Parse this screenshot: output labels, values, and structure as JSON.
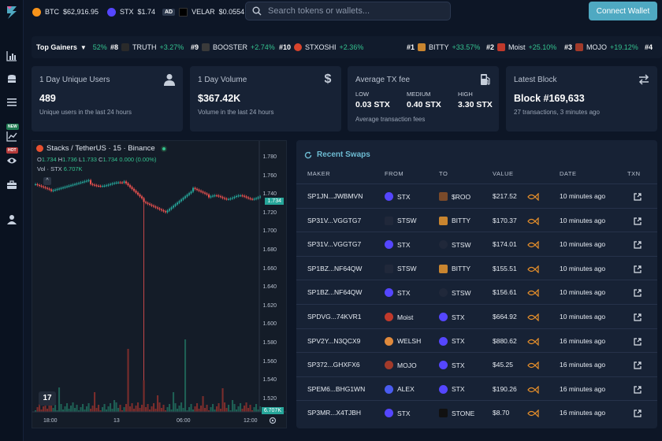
{
  "top_bar": {
    "tickers": [
      {
        "symbol": "BTC",
        "price": "$62,916.95",
        "color": "#f7931a"
      },
      {
        "symbol": "STX",
        "price": "$1.74",
        "color": "#5546ff"
      },
      {
        "ad": "AD",
        "symbol": "VELAR",
        "price": "$0.0554",
        "color": "#000000"
      }
    ],
    "search_placeholder": "Search tokens or wallets...",
    "connect_label": "Connect Wallet"
  },
  "sidebar": {
    "items": [
      {
        "icon": "bar-chart-icon"
      },
      {
        "icon": "coins-icon"
      },
      {
        "icon": "list-icon"
      },
      {
        "badge": "NEW",
        "icon": "trending-chart-icon",
        "badge_color": "#1f7a52"
      },
      {
        "badge": "HOT",
        "icon": "eye-icon",
        "badge_color": "#b43a3a"
      },
      {
        "icon": "briefcase-icon"
      },
      {
        "icon": "user-icon"
      }
    ]
  },
  "gainers": {
    "label": "Top Gainers",
    "pct": "52%",
    "items": [
      {
        "rank": "#8",
        "name": "TRUTH",
        "pct": "+3.27%"
      },
      {
        "rank": "#9",
        "name": "BOOSTER",
        "pct": "+2.74%"
      },
      {
        "rank": "#10",
        "name": "STXOSHI",
        "pct": "+2.36%"
      },
      {
        "rank": "#1",
        "name": "BITTY",
        "pct": "+33.57%"
      },
      {
        "rank": "#2",
        "name": "Moist",
        "pct": "+25.10%"
      },
      {
        "rank": "#3",
        "name": "MOJO",
        "pct": "+19.12%"
      },
      {
        "rank": "#4",
        "name": "",
        "pct": ""
      }
    ]
  },
  "stats": {
    "users": {
      "label": "1 Day Unique Users",
      "value": "489",
      "sub": "Unique users in the last 24 hours"
    },
    "volume": {
      "label": "1 Day Volume",
      "value": "$367.42K",
      "sub": "Volume in the last 24 hours"
    },
    "txfee": {
      "label": "Average TX fee",
      "low_label": "LOW",
      "low": "0.03 STX",
      "medium_label": "MEDIUM",
      "medium": "0.40 STX",
      "high_label": "HIGH",
      "high": "3.30 STX",
      "sub": "Average transaction fees"
    },
    "block": {
      "label": "Latest Block",
      "value": "Block #169,633",
      "sub": "27 transactions, 3 minutes ago"
    }
  },
  "chart": {
    "title": "Stacks / TetherUS · 15 · Binance",
    "ohlc": {
      "o": "1.734",
      "h": "1.736",
      "l": "1.733",
      "c": "1.734",
      "change": "0.000 (0.00%)"
    },
    "vol_label": "Vol · STX",
    "vol_value": "6.707K",
    "price_tag": "1.734",
    "vol_tag": "6.707K",
    "y_ticks": [
      "1.780",
      "1.760",
      "1.740",
      "1.720",
      "1.700",
      "1.680",
      "1.660",
      "1.640",
      "1.620",
      "1.600",
      "1.580",
      "1.560",
      "1.540",
      "1.520"
    ],
    "x_ticks": [
      "18:00",
      "13",
      "06:00",
      "12:00"
    ],
    "up_color": "#26a69a",
    "down_color": "#ef5350"
  },
  "swaps": {
    "title": "Recent Swaps",
    "headers": {
      "maker": "MAKER",
      "from": "FROM",
      "to": "TO",
      "value": "VALUE",
      "date": "DATE",
      "txn": "TXN"
    },
    "rows": [
      {
        "maker": "SP1JN...JWBMVN",
        "from": "STX",
        "to": "$ROO",
        "value": "$217.52",
        "date": "10 minutes ago",
        "fish": true
      },
      {
        "maker": "SP31V...VGGTG7",
        "from": "STSW",
        "to": "BITTY",
        "value": "$170.37",
        "date": "10 minutes ago",
        "fish": true
      },
      {
        "maker": "SP31V...VGGTG7",
        "from": "STX",
        "to": "STSW",
        "value": "$174.01",
        "date": "10 minutes ago",
        "fish": true
      },
      {
        "maker": "SP1BZ...NF64QW",
        "from": "STSW",
        "to": "BITTY",
        "value": "$155.51",
        "date": "10 minutes ago",
        "fish": true
      },
      {
        "maker": "SP1BZ...NF64QW",
        "from": "STX",
        "to": "STSW",
        "value": "$156.61",
        "date": "10 minutes ago",
        "fish": true
      },
      {
        "maker": "SPDVG...74KVR1",
        "from": "Moist",
        "to": "STX",
        "value": "$664.92",
        "date": "10 minutes ago",
        "fish": true
      },
      {
        "maker": "SPV2Y...N3QCX9",
        "from": "WELSH",
        "to": "STX",
        "value": "$880.62",
        "date": "16 minutes ago",
        "fish": true
      },
      {
        "maker": "SP372...GHXFX6",
        "from": "MOJO",
        "to": "STX",
        "value": "$45.25",
        "date": "16 minutes ago",
        "fish": true
      },
      {
        "maker": "SPEM6...BHG1WN",
        "from": "ALEX",
        "to": "STX",
        "value": "$190.26",
        "date": "16 minutes ago",
        "fish": true
      },
      {
        "maker": "SP3MR...X4TJBH",
        "from": "STX",
        "to": "STONE",
        "value": "$8.70",
        "date": "16 minutes ago",
        "fish": true
      }
    ],
    "token_colors": {
      "STX": "#5546ff",
      "$ROO": "#7a4a2a",
      "STSW": "#20283a",
      "BITTY": "#c9852f",
      "Moist": "#c0392b",
      "WELSH": "#e08a3c",
      "MOJO": "#a23a2a",
      "ALEX": "#4a5cf0",
      "STONE": "#111111"
    }
  }
}
